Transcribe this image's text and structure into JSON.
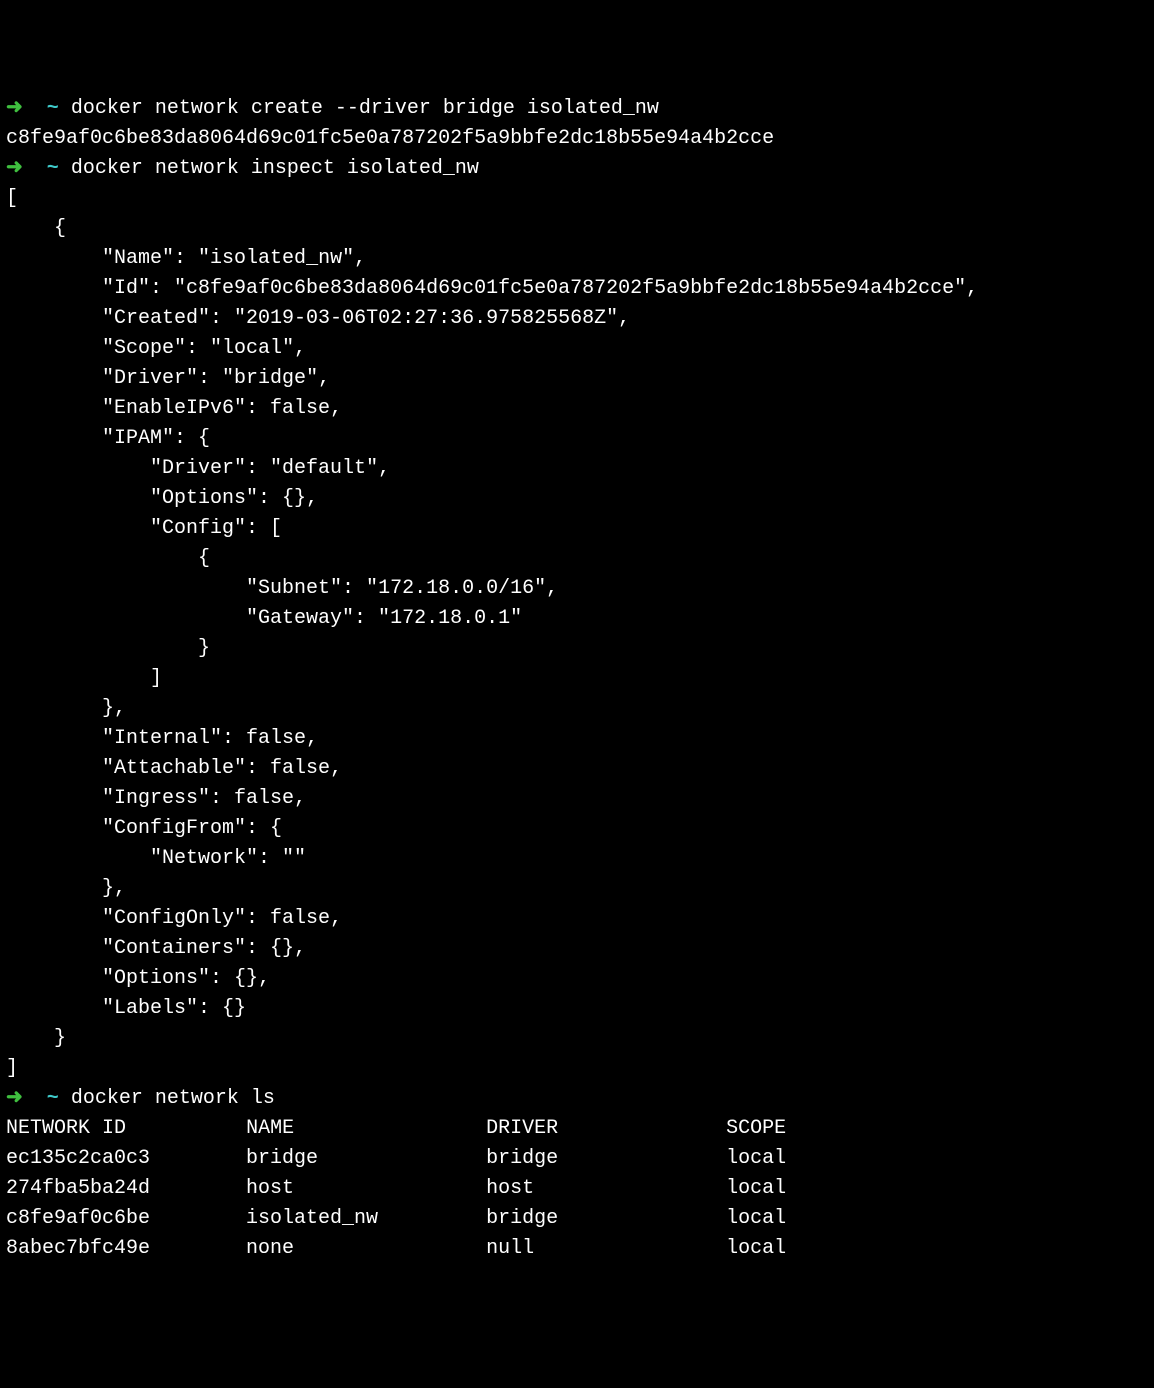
{
  "prompt": {
    "arrow": "➜",
    "tilde": "~"
  },
  "cmd1": "docker network create --driver bridge isolated_nw",
  "out1": "c8fe9af0c6be83da8064d69c01fc5e0a787202f5a9bbfe2dc18b55e94a4b2cce",
  "cmd2": "docker network inspect isolated_nw",
  "inspect": {
    "Name": "isolated_nw",
    "Id": "c8fe9af0c6be83da8064d69c01fc5e0a787202f5a9bbfe2dc18b55e94a4b2cce",
    "Created": "2019-03-06T02:27:36.975825568Z",
    "Scope": "local",
    "Driver": "bridge",
    "EnableIPv6": "false",
    "IPAM_Driver": "default",
    "IPAM_Options": "{}",
    "Subnet": "172.18.0.0/16",
    "Gateway": "172.18.0.1",
    "Internal": "false",
    "Attachable": "false",
    "Ingress": "false",
    "ConfigFrom_Network": "",
    "ConfigOnly": "false",
    "Containers": "{}",
    "Options": "{}",
    "Labels": "{}"
  },
  "cmd3": "docker network ls",
  "ls": {
    "headers": {
      "id": "NETWORK ID",
      "name": "NAME",
      "driver": "DRIVER",
      "scope": "SCOPE"
    },
    "rows": [
      {
        "id": "ec135c2ca0c3",
        "name": "bridge",
        "driver": "bridge",
        "scope": "local"
      },
      {
        "id": "274fba5ba24d",
        "name": "host",
        "driver": "host",
        "scope": "local"
      },
      {
        "id": "c8fe9af0c6be",
        "name": "isolated_nw",
        "driver": "bridge",
        "scope": "local"
      },
      {
        "id": "8abec7bfc49e",
        "name": "none",
        "driver": "null",
        "scope": "local"
      }
    ]
  }
}
